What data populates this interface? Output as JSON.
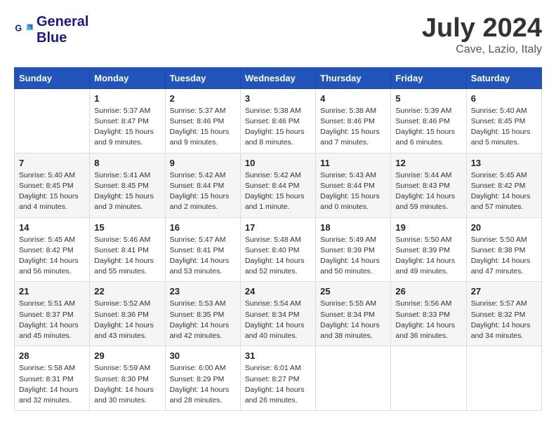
{
  "header": {
    "logo_line1": "General",
    "logo_line2": "Blue",
    "month": "July 2024",
    "location": "Cave, Lazio, Italy"
  },
  "weekdays": [
    "Sunday",
    "Monday",
    "Tuesday",
    "Wednesday",
    "Thursday",
    "Friday",
    "Saturday"
  ],
  "weeks": [
    [
      {
        "day": "",
        "info": ""
      },
      {
        "day": "1",
        "info": "Sunrise: 5:37 AM\nSunset: 8:47 PM\nDaylight: 15 hours\nand 9 minutes."
      },
      {
        "day": "2",
        "info": "Sunrise: 5:37 AM\nSunset: 8:46 PM\nDaylight: 15 hours\nand 9 minutes."
      },
      {
        "day": "3",
        "info": "Sunrise: 5:38 AM\nSunset: 8:46 PM\nDaylight: 15 hours\nand 8 minutes."
      },
      {
        "day": "4",
        "info": "Sunrise: 5:38 AM\nSunset: 8:46 PM\nDaylight: 15 hours\nand 7 minutes."
      },
      {
        "day": "5",
        "info": "Sunrise: 5:39 AM\nSunset: 8:46 PM\nDaylight: 15 hours\nand 6 minutes."
      },
      {
        "day": "6",
        "info": "Sunrise: 5:40 AM\nSunset: 8:45 PM\nDaylight: 15 hours\nand 5 minutes."
      }
    ],
    [
      {
        "day": "7",
        "info": "Sunrise: 5:40 AM\nSunset: 8:45 PM\nDaylight: 15 hours\nand 4 minutes."
      },
      {
        "day": "8",
        "info": "Sunrise: 5:41 AM\nSunset: 8:45 PM\nDaylight: 15 hours\nand 3 minutes."
      },
      {
        "day": "9",
        "info": "Sunrise: 5:42 AM\nSunset: 8:44 PM\nDaylight: 15 hours\nand 2 minutes."
      },
      {
        "day": "10",
        "info": "Sunrise: 5:42 AM\nSunset: 8:44 PM\nDaylight: 15 hours\nand 1 minute."
      },
      {
        "day": "11",
        "info": "Sunrise: 5:43 AM\nSunset: 8:44 PM\nDaylight: 15 hours\nand 0 minutes."
      },
      {
        "day": "12",
        "info": "Sunrise: 5:44 AM\nSunset: 8:43 PM\nDaylight: 14 hours\nand 59 minutes."
      },
      {
        "day": "13",
        "info": "Sunrise: 5:45 AM\nSunset: 8:42 PM\nDaylight: 14 hours\nand 57 minutes."
      }
    ],
    [
      {
        "day": "14",
        "info": "Sunrise: 5:45 AM\nSunset: 8:42 PM\nDaylight: 14 hours\nand 56 minutes."
      },
      {
        "day": "15",
        "info": "Sunrise: 5:46 AM\nSunset: 8:41 PM\nDaylight: 14 hours\nand 55 minutes."
      },
      {
        "day": "16",
        "info": "Sunrise: 5:47 AM\nSunset: 8:41 PM\nDaylight: 14 hours\nand 53 minutes."
      },
      {
        "day": "17",
        "info": "Sunrise: 5:48 AM\nSunset: 8:40 PM\nDaylight: 14 hours\nand 52 minutes."
      },
      {
        "day": "18",
        "info": "Sunrise: 5:49 AM\nSunset: 8:39 PM\nDaylight: 14 hours\nand 50 minutes."
      },
      {
        "day": "19",
        "info": "Sunrise: 5:50 AM\nSunset: 8:39 PM\nDaylight: 14 hours\nand 49 minutes."
      },
      {
        "day": "20",
        "info": "Sunrise: 5:50 AM\nSunset: 8:38 PM\nDaylight: 14 hours\nand 47 minutes."
      }
    ],
    [
      {
        "day": "21",
        "info": "Sunrise: 5:51 AM\nSunset: 8:37 PM\nDaylight: 14 hours\nand 45 minutes."
      },
      {
        "day": "22",
        "info": "Sunrise: 5:52 AM\nSunset: 8:36 PM\nDaylight: 14 hours\nand 43 minutes."
      },
      {
        "day": "23",
        "info": "Sunrise: 5:53 AM\nSunset: 8:35 PM\nDaylight: 14 hours\nand 42 minutes."
      },
      {
        "day": "24",
        "info": "Sunrise: 5:54 AM\nSunset: 8:34 PM\nDaylight: 14 hours\nand 40 minutes."
      },
      {
        "day": "25",
        "info": "Sunrise: 5:55 AM\nSunset: 8:34 PM\nDaylight: 14 hours\nand 38 minutes."
      },
      {
        "day": "26",
        "info": "Sunrise: 5:56 AM\nSunset: 8:33 PM\nDaylight: 14 hours\nand 36 minutes."
      },
      {
        "day": "27",
        "info": "Sunrise: 5:57 AM\nSunset: 8:32 PM\nDaylight: 14 hours\nand 34 minutes."
      }
    ],
    [
      {
        "day": "28",
        "info": "Sunrise: 5:58 AM\nSunset: 8:31 PM\nDaylight: 14 hours\nand 32 minutes."
      },
      {
        "day": "29",
        "info": "Sunrise: 5:59 AM\nSunset: 8:30 PM\nDaylight: 14 hours\nand 30 minutes."
      },
      {
        "day": "30",
        "info": "Sunrise: 6:00 AM\nSunset: 8:29 PM\nDaylight: 14 hours\nand 28 minutes."
      },
      {
        "day": "31",
        "info": "Sunrise: 6:01 AM\nSunset: 8:27 PM\nDaylight: 14 hours\nand 26 minutes."
      },
      {
        "day": "",
        "info": ""
      },
      {
        "day": "",
        "info": ""
      },
      {
        "day": "",
        "info": ""
      }
    ]
  ]
}
